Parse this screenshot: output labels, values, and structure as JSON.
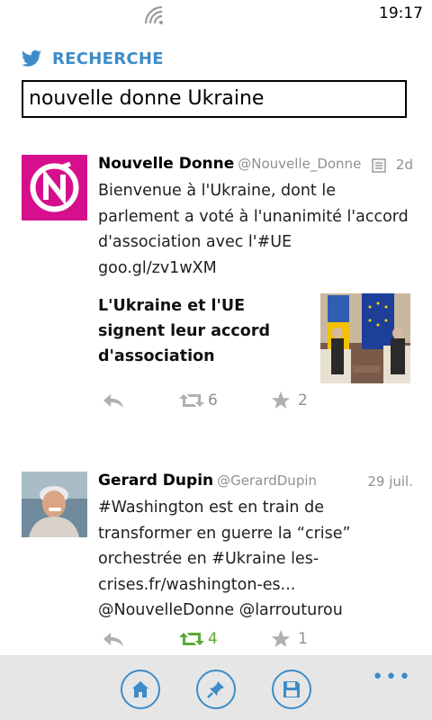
{
  "status_bar": {
    "time": "19:17"
  },
  "header": {
    "title": "RECHERCHE"
  },
  "search": {
    "value": "nouvelle donne Ukraine"
  },
  "tweets": [
    {
      "name": "Nouvelle Donne",
      "handle": "@Nouvelle_Donne",
      "date": "2d",
      "text": "Bienvenue à l'Ukraine, dont le parlement a voté à l'unanimité l'accord d'association avec l'#UE goo.gl/zv1wXM",
      "card_title": "L'Ukraine et l'UE signent leur accord d'association",
      "retweets": "6",
      "favorites": "2",
      "retweeted": false
    },
    {
      "name": "Gerard Dupin",
      "handle": "@GerardDupin",
      "date": "29 juil.",
      "text": "#Washington est en train de transformer en guerre la “crise” orchestrée en #Ukraine  les-crises.fr/washington-es... @NouvelleDonne @larrouturou",
      "retweets": "4",
      "favorites": "1",
      "retweeted": true
    }
  ],
  "app_bar": {
    "more": "•••"
  },
  "colors": {
    "accent": "#3d8cc8",
    "retweeted": "#5aa838",
    "meta_gray": "#909090",
    "brand_magenta": "#d6108c"
  }
}
